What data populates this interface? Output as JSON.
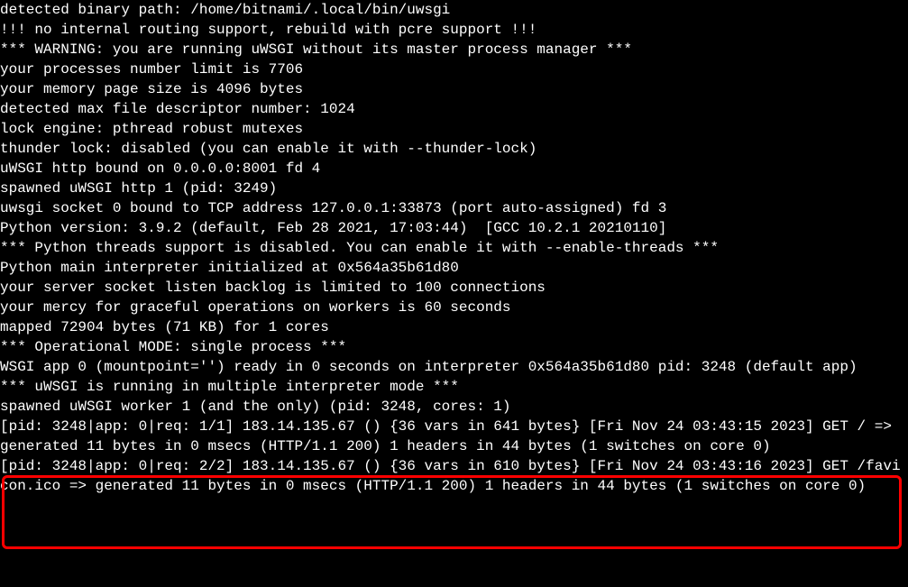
{
  "terminal": {
    "lines": [
      "detected binary path: /home/bitnami/.local/bin/uwsgi",
      "!!! no internal routing support, rebuild with pcre support !!!",
      "*** WARNING: you are running uWSGI without its master process manager ***",
      "your processes number limit is 7706",
      "your memory page size is 4096 bytes",
      "detected max file descriptor number: 1024",
      "lock engine: pthread robust mutexes",
      "thunder lock: disabled (you can enable it with --thunder-lock)",
      "uWSGI http bound on 0.0.0.0:8001 fd 4",
      "spawned uWSGI http 1 (pid: 3249)",
      "uwsgi socket 0 bound to TCP address 127.0.0.1:33873 (port auto-assigned) fd 3",
      "Python version: 3.9.2 (default, Feb 28 2021, 17:03:44)  [GCC 10.2.1 20210110]",
      "*** Python threads support is disabled. You can enable it with --enable-threads ***",
      "Python main interpreter initialized at 0x564a35b61d80",
      "your server socket listen backlog is limited to 100 connections",
      "your mercy for graceful operations on workers is 60 seconds",
      "mapped 72904 bytes (71 KB) for 1 cores",
      "*** Operational MODE: single process ***",
      "WSGI app 0 (mountpoint='') ready in 0 seconds on interpreter 0x564a35b61d80 pid: 3248 (default app)",
      "*** uWSGI is running in multiple interpreter mode ***",
      "spawned uWSGI worker 1 (and the only) (pid: 3248, cores: 1)",
      "[pid: 3248|app: 0|req: 1/1] 183.14.135.67 () {36 vars in 641 bytes} [Fri Nov 24 03:43:15 2023] GET / => generated 11 bytes in 0 msecs (HTTP/1.1 200) 1 headers in 44 bytes (1 switches on core 0)",
      "[pid: 3248|app: 0|req: 2/2] 183.14.135.67 () {36 vars in 610 bytes} [Fri Nov 24 03:43:16 2023] GET /favicon.ico => generated 11 bytes in 0 msecs (HTTP/1.1 200) 1 headers in 44 bytes (1 switches on core 0)"
    ]
  },
  "highlight": {
    "start_line_index": 22
  }
}
